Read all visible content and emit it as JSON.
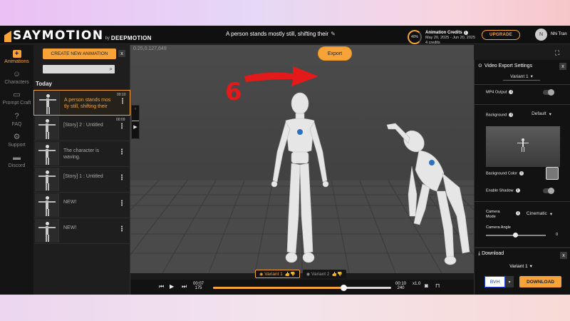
{
  "app": {
    "logo_text": "SAYMOTION",
    "logo_by": "by",
    "logo_brand": "DEEPMOTION"
  },
  "header": {
    "project_title": "A person stands mostly still, shifting their",
    "credits": {
      "ring_label": "40%",
      "title": "Animation Credits",
      "date_range": "May 20, 2025 - Jun 20, 2025",
      "count": "4 credits"
    },
    "upgrade_label": "UPGRADE",
    "avatar_initial": "N",
    "user_name": "Nhi Tran"
  },
  "nav": [
    {
      "label": "Animations",
      "icon": "plus-icon",
      "glyph": "+"
    },
    {
      "label": "Characters",
      "icon": "person-icon",
      "glyph": "☺"
    },
    {
      "label": "Prompt Craft",
      "icon": "keyboard-icon",
      "glyph": "▭"
    },
    {
      "label": "FAQ",
      "icon": "question-icon",
      "glyph": "?"
    },
    {
      "label": "Support",
      "icon": "gear-icon",
      "glyph": "⚙"
    },
    {
      "label": "Discord",
      "icon": "chat-icon",
      "glyph": "▬"
    }
  ],
  "panel": {
    "create_label": "CREATE NEW ANIMATION",
    "close_glyph": "x",
    "search_placeholder": "",
    "section_label": "Today",
    "items": [
      {
        "title": "A person stands mos tly still, shifting their",
        "duration": "00:10"
      },
      {
        "title": "[Story] 2 : Untitled",
        "duration": "00:09"
      },
      {
        "title": "The character is waving.",
        "duration": ""
      },
      {
        "title": "[Story] 1 : Untitled",
        "duration": ""
      },
      {
        "title": "NEW!",
        "duration": ""
      },
      {
        "title": "NEW!",
        "duration": ""
      }
    ]
  },
  "viewport": {
    "coords": "0.25,0.127,649",
    "export_label": "Export",
    "annotation_number": "6",
    "variants": [
      {
        "label": "Variant 1",
        "selected": true
      },
      {
        "label": "Variant 2",
        "selected": false
      }
    ]
  },
  "timeline": {
    "current_time": "00:07",
    "current_frame": "175",
    "total_time": "00:10",
    "total_frame": "240",
    "speed": "x1.0",
    "progress": 0.73
  },
  "export_settings": {
    "title": "Video Export Settings",
    "variant": "Variant 1",
    "mp4_label": "MP4 Output",
    "background_label": "Background",
    "background_value": "Default",
    "bg_color_label": "Background Color",
    "bg_color": "#777777",
    "shadow_label": "Enable Shadow",
    "camera_mode_label": "Camera Mode",
    "camera_mode_value": "Cinematic",
    "camera_angle_label": "Camera Angle",
    "camera_angle_value": "0"
  },
  "download": {
    "title": "Download",
    "variant": "Variant 1",
    "format": "BVH",
    "button_label": "DOWNLOAD"
  },
  "colors": {
    "accent": "#f7a338",
    "annotation": "#e41a1a",
    "bg": "#1b1b1b"
  }
}
